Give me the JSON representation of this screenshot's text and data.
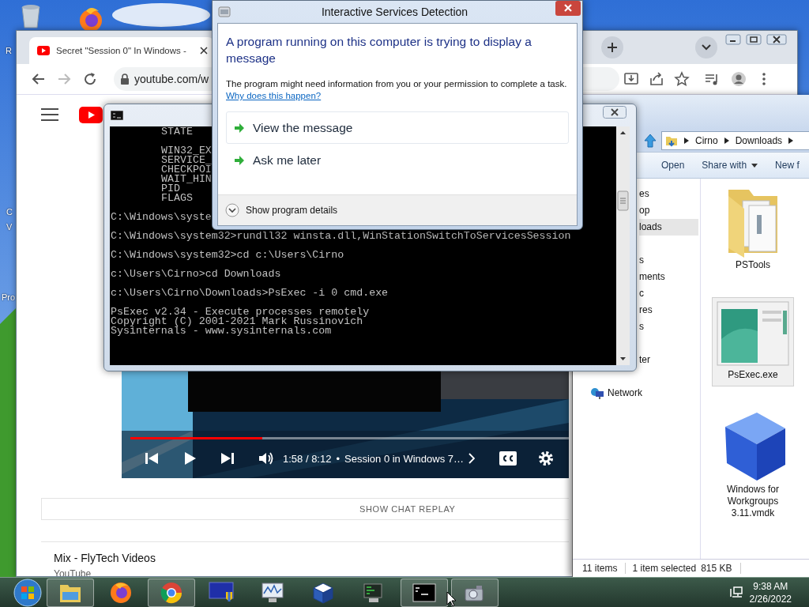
{
  "desktop": {
    "icons": [
      {
        "label": "R"
      },
      {
        "label": "C"
      },
      {
        "label": "V"
      },
      {
        "label": "Pro"
      }
    ]
  },
  "browser": {
    "tab": {
      "title": "Secret \"Session 0\" In Windows -",
      "selected": true
    },
    "address": "youtube.com/w",
    "page": {
      "video": {
        "kind": "picture",
        "progress": {
          "level": 0.3
        },
        "time": "1:58 / 8:12",
        "separator": "•",
        "chapter": "Session 0 in Windows 7…"
      },
      "chat_replay": "SHOW CHAT REPLAY",
      "mix": {
        "title": "Mix - FlyTech Videos",
        "channel": "YouTube"
      }
    }
  },
  "console": {
    "blocks": [
      {
        "kind": "status",
        "lines": [
          "STATE"
        ]
      },
      {
        "kind": "status",
        "lines": [
          "WIN32_EX",
          "SERVICE_",
          "CHECKPOI",
          "WAIT_HIN",
          "PID",
          "FLAGS"
        ]
      },
      {
        "kind": "prompt",
        "lines": [
          "C:\\Windows\\syste"
        ]
      },
      {
        "kind": "prompt",
        "lines": [
          "C:\\Windows\\system32>rundll32 winsta.dll,WinStationSwitchToServicesSession"
        ]
      },
      {
        "kind": "prompt",
        "lines": [
          "C:\\Windows\\system32>cd c:\\Users\\Cirno"
        ]
      },
      {
        "kind": "prompt",
        "lines": [
          "c:\\Users\\Cirno>cd Downloads"
        ]
      },
      {
        "kind": "prompt",
        "lines": [
          "c:\\Users\\Cirno\\Downloads>PsExec -i 0 cmd.exe"
        ]
      },
      {
        "kind": "output",
        "lines": [
          "PsExec v2.34 - Execute processes remotely",
          "Copyright (C) 2001-2021 Mark Russinovich",
          "Sysinternals - www.sysinternals.com"
        ]
      }
    ]
  },
  "dialog": {
    "title": "Interactive Services Detection",
    "heading": "A program running on this computer is trying to display a message",
    "body": "The program might need information from you or your permission to complete a task.",
    "link": "Why does this happen?",
    "options": [
      {
        "label": "View the message",
        "highlighted": true
      },
      {
        "label": "Ask me later",
        "highlighted": false
      }
    ],
    "details": "Show program details"
  },
  "explorer": {
    "breadcrumb": [
      "Cirno",
      "Downloads"
    ],
    "toolbar": [
      {
        "label": "Open",
        "dropdown": false
      },
      {
        "label": "Share with",
        "dropdown": true
      },
      {
        "label": "New f",
        "dropdown": false
      }
    ],
    "nav": {
      "groups": [
        [
          {
            "label": "es",
            "selected": false
          },
          {
            "label": "op",
            "selected": false
          },
          {
            "label": "loads",
            "selected": true
          }
        ],
        [
          {
            "label": "s",
            "selected": false
          },
          {
            "label": "ments",
            "selected": false
          },
          {
            "label": "c",
            "selected": false
          },
          {
            "label": "res",
            "selected": false
          },
          {
            "label": "s",
            "selected": false
          }
        ],
        [
          {
            "label": "ter",
            "selected": false
          }
        ]
      ],
      "network": "Network"
    },
    "files": [
      {
        "name": "PSTools",
        "kind": "folder",
        "selected": false
      },
      {
        "name": "PsExec.exe",
        "kind": "exe",
        "selected": true
      },
      {
        "name": "Windows for Workgroups 3.11.vmdk",
        "kind": "vmdk",
        "selected": false
      }
    ],
    "status": {
      "count": "11 items",
      "selection": "1 item selected",
      "size": "815 KB"
    }
  },
  "taskbar": {
    "apps": [
      {
        "kind": "explorer",
        "running": true
      },
      {
        "kind": "firefox",
        "running": false
      },
      {
        "kind": "chrome",
        "running": true
      },
      {
        "kind": "security",
        "running": false
      },
      {
        "kind": "monitor",
        "running": false
      },
      {
        "kind": "virtualbox",
        "running": false
      },
      {
        "kind": "network",
        "running": false
      },
      {
        "kind": "console",
        "running": true
      },
      {
        "kind": "camera",
        "running": true
      }
    ],
    "clock": {
      "time": "9:38 AM",
      "date": "2/26/2022"
    }
  }
}
